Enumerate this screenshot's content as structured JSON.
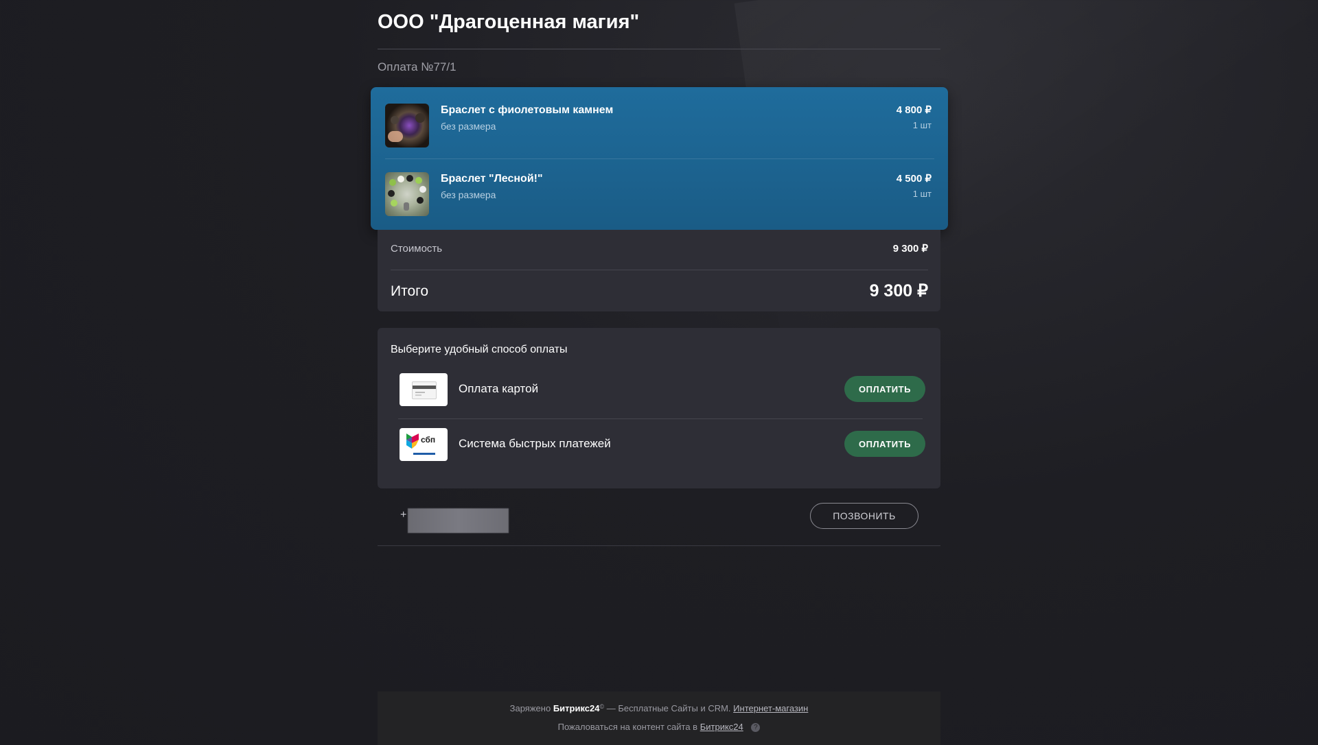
{
  "company": {
    "name": "ООО \"Драгоценная магия\""
  },
  "payment": {
    "number": "Оплата №77/1"
  },
  "items": [
    {
      "name": "Браслет с фиолетовым камнем",
      "size": "без размера",
      "price": "4 800 ₽",
      "quantity": "1 шт",
      "icon": "bracelet-purple-stone-photo"
    },
    {
      "name": "Браслет \"Лесной!\"",
      "size": "без размера",
      "price": "4 500 ₽",
      "quantity": "1 шт",
      "icon": "bracelet-forest-photo"
    }
  ],
  "summary": {
    "cost_label": "Стоимость",
    "cost_value": "9 300 ₽",
    "total_label": "Итого",
    "total_value": "9 300 ₽"
  },
  "payment_methods": {
    "title": "Выберите удобный способ оплаты",
    "methods": [
      {
        "name": "Оплата картой",
        "button": "ОПЛАТИТЬ",
        "icon": "credit-card-icon"
      },
      {
        "name": "Система быстрых платежей",
        "button": "ОПЛАТИТЬ",
        "icon": "sbp-logo",
        "logo_text": "сбп"
      }
    ]
  },
  "contact": {
    "phone_prefix": "+",
    "call_button": "ПОЗВОНИТЬ"
  },
  "footer": {
    "powered_prefix": "Заряжено",
    "brand": "Битрикс24",
    "brand_mark": "©",
    "powered_suffix": "— Бесплатные Сайты и CRM.",
    "shop_link": "Интернет-магазин",
    "complaint_text": "Пожаловаться на контент сайта в",
    "complaint_link": "Битрикс24",
    "help_icon": "?"
  },
  "colors": {
    "page_bg": "#1e1e23",
    "items_card": "#1f6c9c",
    "card_bg": "#2e2e36",
    "pay_button": "#2e6b4a",
    "footer_bg": "#232325"
  }
}
